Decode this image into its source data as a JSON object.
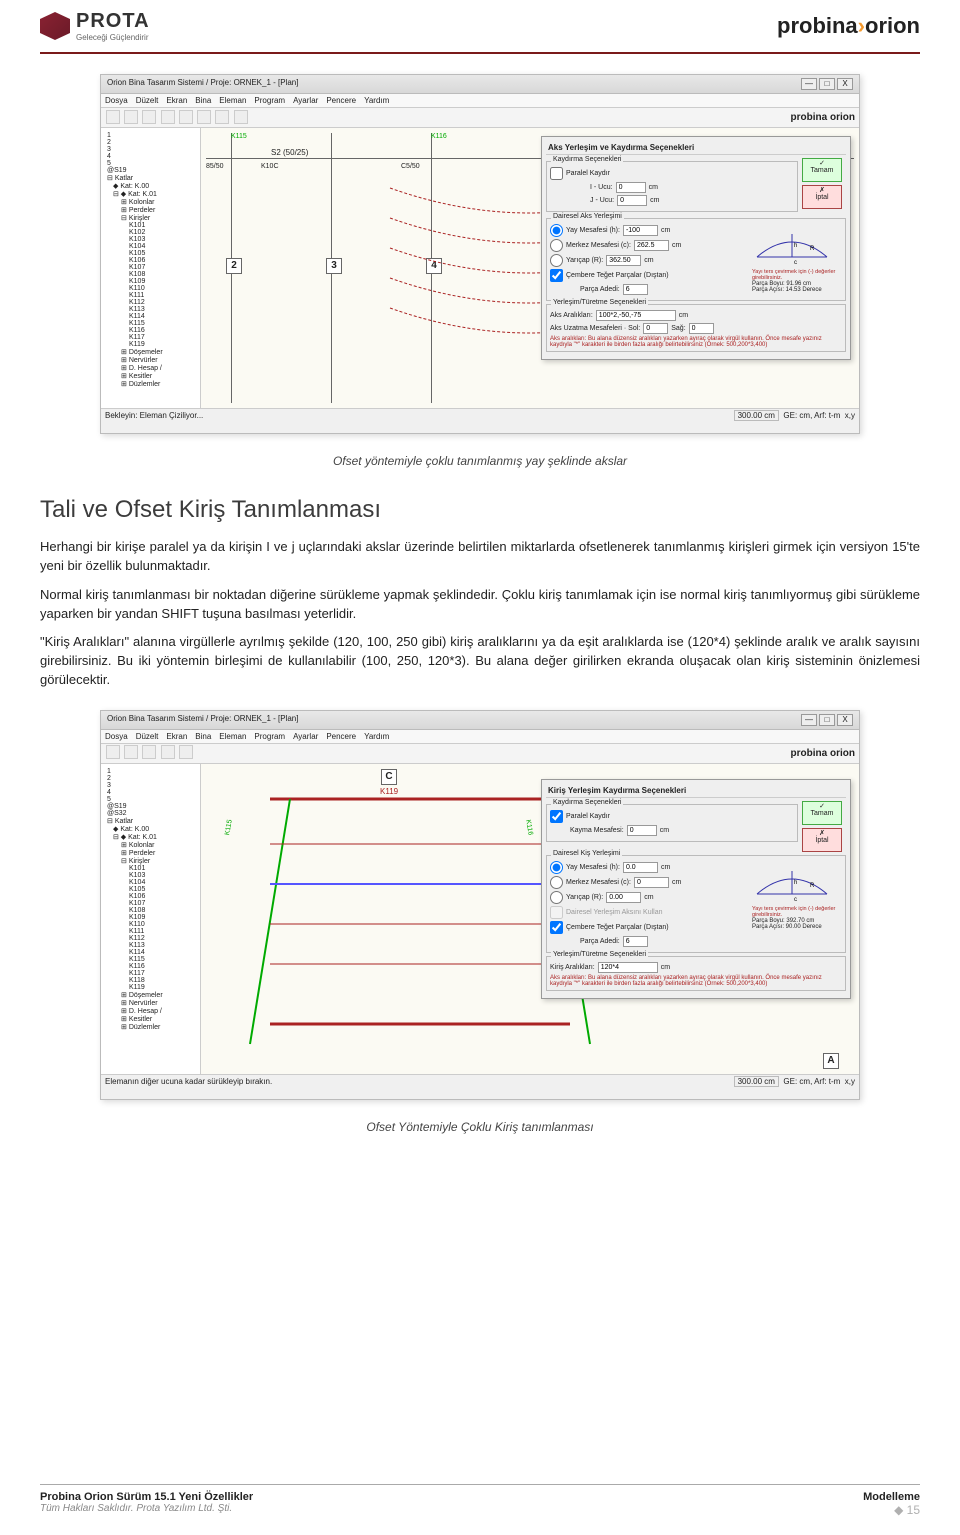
{
  "header": {
    "logo_main": "PROTA",
    "logo_sub": "Geleceği Güçlendirir",
    "brand_right_1": "probina",
    "brand_right_2": "orion"
  },
  "screenshot1": {
    "title": "Orion Bina Tasarım Sistemi / Proje: ORNEK_1 - [Plan]",
    "menu": [
      "Dosya",
      "Düzelt",
      "Ekran",
      "Bina",
      "Eleman",
      "Program",
      "Ayarlar",
      "Pencere",
      "Yardım"
    ],
    "tree_top": [
      "1",
      "2",
      "3",
      "4",
      "5",
      "@S19"
    ],
    "tree_katlar": "Katlar",
    "tree_kat00": "Kat: K.00",
    "tree_kat01": "Kat: K.01",
    "tree_kolonlar": "Kolonlar",
    "tree_perdeler": "Perdeler",
    "tree_kirisler": "Kirişler",
    "kiris_items": [
      "K101",
      "K102",
      "K103",
      "K104",
      "K105",
      "K106",
      "K107",
      "K108",
      "K109",
      "K110",
      "K111",
      "K112",
      "K113",
      "K114",
      "K115",
      "K116",
      "K117",
      "K119"
    ],
    "tree_other": [
      "Döşemeler",
      "Nervürler",
      "D. Hesap /",
      "Kesitler",
      "Düzlemler"
    ],
    "axis_labels": [
      "2",
      "3",
      "4"
    ],
    "beam_label": "S2 (50/25)",
    "coord_label1": "K115",
    "coord_label2": "K116",
    "left_coord": "85/50",
    "mid_coord": "K10C",
    "right_coord": "C5/50",
    "panel_title": "Aks Yerleşim ve Kaydırma Seçenekleri",
    "group_kaydirma": "Kaydırma Seçenekleri",
    "paralel_kaydir": "Paralel Kaydır",
    "i_ucu_label": "I - Ucu:",
    "i_ucu_val": "0",
    "j_ucu_label": "J - Ucu:",
    "j_ucu_val": "0",
    "cm": "cm",
    "tamam": "Tamam",
    "iptal": "İptal",
    "group_dairesel": "Dairesel Aks Yerleşimi",
    "yay_mesafesi": "Yay Mesafesi (h):",
    "yay_val": "-100",
    "merkez": "Merkez Mesafesi (c):",
    "merkez_val": "262.5",
    "yaricap": "Yarıçap (R):",
    "yaricap_val": "362.50",
    "cembere": "Çembere Teğet Parçalar (Dıştan)",
    "parca_adedi": "Parça Adedi:",
    "parca_val": "6",
    "parca_boyu": "Parça Boyu: 91.96 cm",
    "parca_acisi": "Parça Açısı: 14.53 Derece",
    "yay_note": "Yayı ters çevirmek için (-) değerler girebilirsiniz.",
    "group_yerlesim": "Yerleşim/Türetme Seçenekleri",
    "aks_araliklari": "Aks Aralıkları:",
    "aks_araliklari_val": "100*2,-50,-75",
    "aks_uzatma": "Aks Uzatma Mesafeleri · Sol:",
    "sag": "Sağ:",
    "uzatma_val": "0",
    "hint": "Aks aralıkları: Bu alana düzensiz aralıkları yazarken ayıraç olarak virgül kullanın. Önce mesafe yazınız kaydıyla \"*\" karakteri ile birden fazla aralığı belirtebilirsiniz (Örnek: 500,200*3,400)",
    "status_left": "Bekleyin: Eleman Çiziliyor...",
    "status_coord": "300.00 cm",
    "status_units": "GE: cm, Arf: t-m",
    "status_xy": "x,y",
    "logo_r": "probina orion"
  },
  "caption1": "Ofset yöntemiyle çoklu tanımlanmış yay şeklinde akslar",
  "heading1": "Tali ve Ofset Kiriş Tanımlanması",
  "para1": "Herhangi bir kirişe paralel ya da kirişin I ve j uçlarındaki akslar üzerinde belirtilen miktarlarda ofsetlenerek tanımlanmış kirişleri girmek için versiyon 15'te yeni bir özellik bulunmaktadır.",
  "para2": "Normal kiriş tanımlanması bir noktadan diğerine sürükleme yapmak şeklindedir. Çoklu kiriş tanımlamak için ise normal kiriş tanımlıyormuş gibi sürükleme yaparken bir yandan SHIFT tuşuna basılması yeterlidir.",
  "para3": "\"Kiriş Aralıkları\" alanına virgüllerle ayrılmış şekilde (120, 100, 250 gibi) kiriş aralıklarını ya da eşit aralıklarda ise (120*4) şeklinde aralık ve aralık sayısını girebilirsiniz. Bu iki yöntemin birleşimi de kullanılabilir (100, 250, 120*3).  Bu alana değer girilirken ekranda oluşacak olan kiriş sisteminin önizlemesi görülecektir.",
  "screenshot2": {
    "title": "Orion Bina Tasarım Sistemi / Proje: ORNEK_1 - [Plan]",
    "menu": [
      "Dosya",
      "Düzelt",
      "Ekran",
      "Bina",
      "Eleman",
      "Program",
      "Ayarlar",
      "Pencere",
      "Yardım"
    ],
    "tree_top": [
      "1",
      "2",
      "3",
      "4",
      "5",
      "@S19",
      "@S32"
    ],
    "tree_katlar": "Katlar",
    "tree_kat00": "Kat: K.00",
    "tree_kat01": "Kat: K.01",
    "tree_kolonlar": "Kolonlar",
    "tree_perdeler": "Perdeler",
    "tree_kirisler": "Kirişler",
    "kiris_items": [
      "K101",
      "K103",
      "K104",
      "K105",
      "K106",
      "K107",
      "K108",
      "K109",
      "K110",
      "K111",
      "K112",
      "K113",
      "K114",
      "K115",
      "K116",
      "K117",
      "K118",
      "K119"
    ],
    "tree_other": [
      "Döşemeler",
      "Nervürler",
      "D. Hesap /",
      "Kesitler",
      "Düzlemler"
    ],
    "axis_labels_top": "C",
    "axis_labels_right": "A",
    "beam_top": "K119",
    "beam_mid": "K115",
    "beam_bottom": "K116",
    "panel_title": "Kiriş Yerleşim Kaydırma Seçenekleri",
    "group_kaydirma": "Kaydırma Seçenekleri",
    "paralel_kaydir": "Paralel Kaydır",
    "kayma_mesafesi": "Kayma Mesafesi:",
    "kayma_val": "0",
    "cm": "cm",
    "tamam": "Tamam",
    "iptal": "İptal",
    "group_dairesel": "Dairesel Kiş Yerleşimi",
    "yay_mesafesi": "Yay Mesafesi (h):",
    "yay_val": "0.0",
    "merkez": "Merkez Mesafesi (c):",
    "merkez_val": "0",
    "yaricap": "Yarıçap (R):",
    "yaricap_val": "0.00",
    "dairesel_aks": "Dairesel Yerleşim Aksını Kullan",
    "cembere": "Çembere Teğet Parçalar (Dıştan)",
    "parca_adedi": "Parça Adedi:",
    "parca_val": "6",
    "parca_boyu": "Parça Boyu: 392.70 cm",
    "parca_acisi": "Parça Açısı: 90.00 Derece",
    "yay_note": "Yayı ters çevirmek için (-) değerler girebilirsiniz.",
    "group_yerlesim": "Yerleşim/Türetme Seçenekleri",
    "kiris_araliklari": "Kiriş Aralıkları:",
    "kiris_araliklari_val": "120*4",
    "hint": "Aks aralıkları: Bu alana düzensiz aralıkları yazarken ayıraç olarak virgül kullanın. Önce mesafe yazınız kaydıyla \"*\" karakteri ile birden fazla aralığı belirtebilirsiniz (Örnek: 500,200*3,400)",
    "status_left": "Elemanın diğer ucuna kadar sürükleyip bırakın.",
    "status_coord": "300.00 cm",
    "status_units": "GE: cm, Arf: t-m",
    "status_xy": "x,y"
  },
  "caption2": "Ofset Yöntemiyle Çoklu Kiriş tanımlanması",
  "footer": {
    "left_main": "Probina Orion Sürüm 15.1 Yeni Özellikler",
    "left_sub": "Tüm Hakları Saklıdır. Prota Yazılım Ltd. Şti.",
    "right_main": "Modelleme",
    "page": "15"
  }
}
